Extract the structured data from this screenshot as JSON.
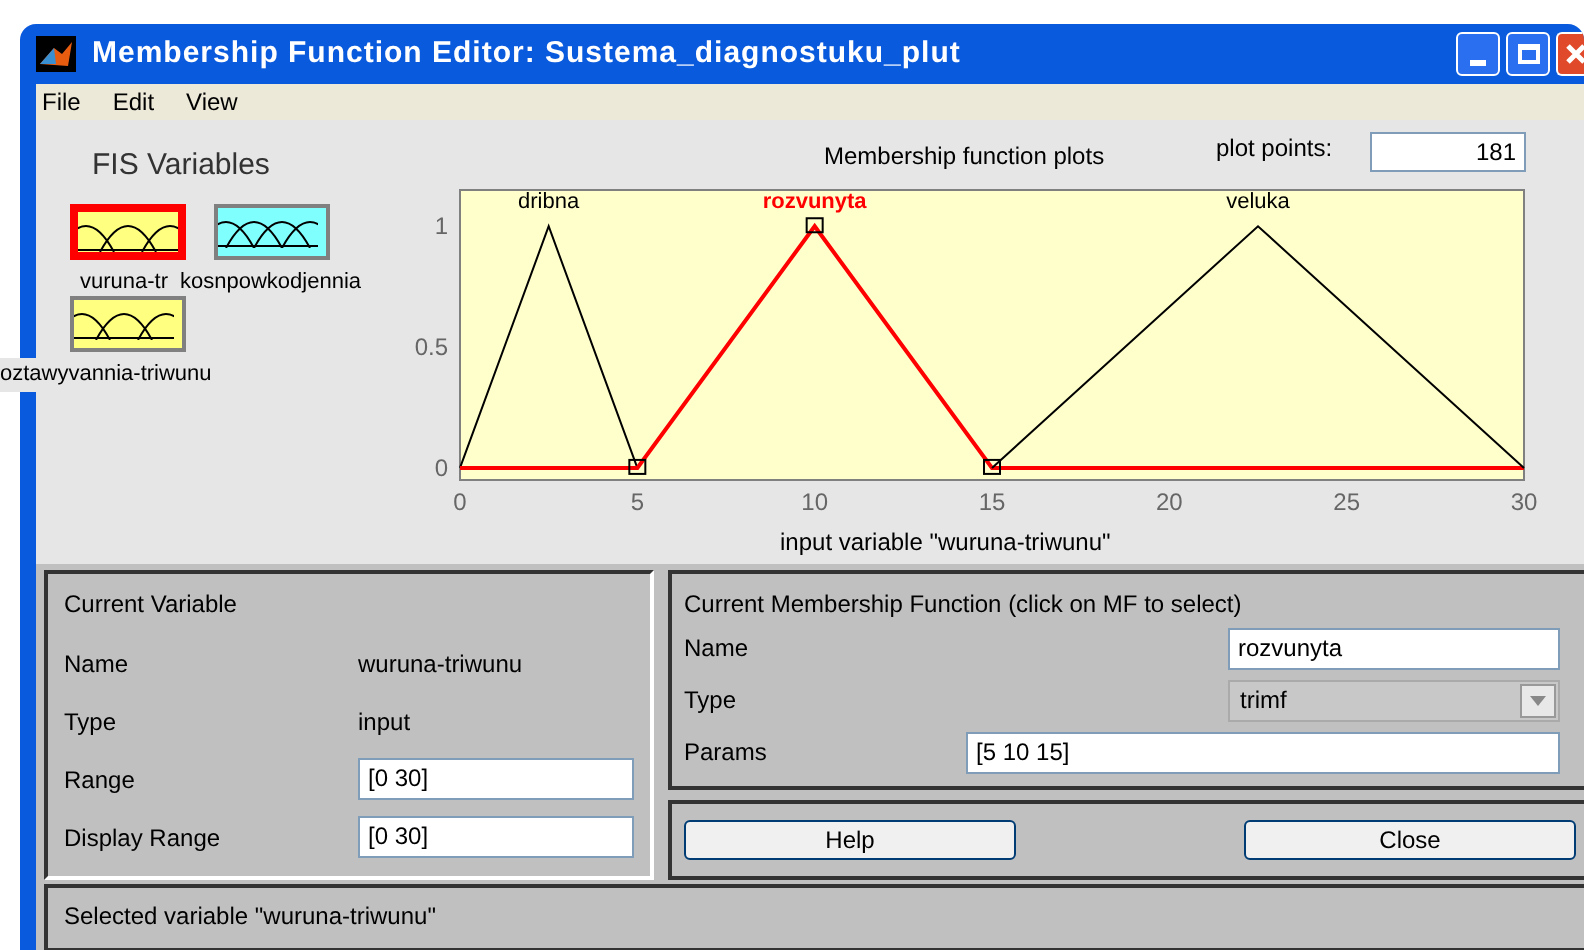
{
  "window": {
    "title": "Membership Function Editor: Sustema_diagnostuku_plut"
  },
  "menu": [
    "File",
    "Edit",
    "View"
  ],
  "fis_variables": {
    "title": "FIS Variables",
    "items": [
      {
        "label": "vuruna-tr",
        "kind": "input",
        "selected": true
      },
      {
        "label": "kosnpowkodjennia",
        "kind": "output",
        "selected": false
      },
      {
        "label": "oztawyvannia-triwunu",
        "kind": "input",
        "selected": false
      }
    ]
  },
  "plot": {
    "title": "Membership function plots",
    "plot_points_label": "plot points:",
    "plot_points": "181",
    "chart_data": {
      "type": "line",
      "xlabel": "input variable \"wuruna-triwunu\"",
      "x": [
        0,
        2.5,
        5,
        10,
        15,
        22.5,
        30
      ],
      "series": [
        {
          "name": "dribna",
          "color": "#000000",
          "values": [
            0,
            1,
            0,
            null,
            null,
            null,
            null
          ]
        },
        {
          "name": "rozvunyta",
          "color": "#ff0000",
          "values": [
            0,
            0,
            0,
            1,
            0,
            0,
            0
          ]
        },
        {
          "name": "veluka",
          "color": "#000000",
          "values": [
            null,
            null,
            null,
            null,
            0,
            1,
            0
          ]
        }
      ],
      "xlim": [
        0,
        30
      ],
      "ylim": [
        -0.05,
        1.15
      ],
      "xticks": [
        0,
        5,
        10,
        15,
        20,
        25,
        30
      ],
      "yticks": [
        0,
        0.5,
        1
      ]
    }
  },
  "current_variable": {
    "title": "Current Variable",
    "rows": [
      {
        "label": "Name",
        "value": "wuruna-triwunu",
        "kind": "text"
      },
      {
        "label": "Type",
        "value": "input",
        "kind": "text"
      },
      {
        "label": "Range",
        "value": "[0 30]",
        "kind": "field"
      },
      {
        "label": "Display Range",
        "value": "[0 30]",
        "kind": "field"
      }
    ]
  },
  "current_mf": {
    "title": "Current Membership Function (click on MF to select)",
    "name_label": "Name",
    "name": "rozvunyta",
    "type_label": "Type",
    "type": "trimf",
    "params_label": "Params",
    "params": "[5 10 15]"
  },
  "buttons": [
    "Help",
    "Close"
  ],
  "status_bar": "Selected variable \"wuruna-triwunu\""
}
